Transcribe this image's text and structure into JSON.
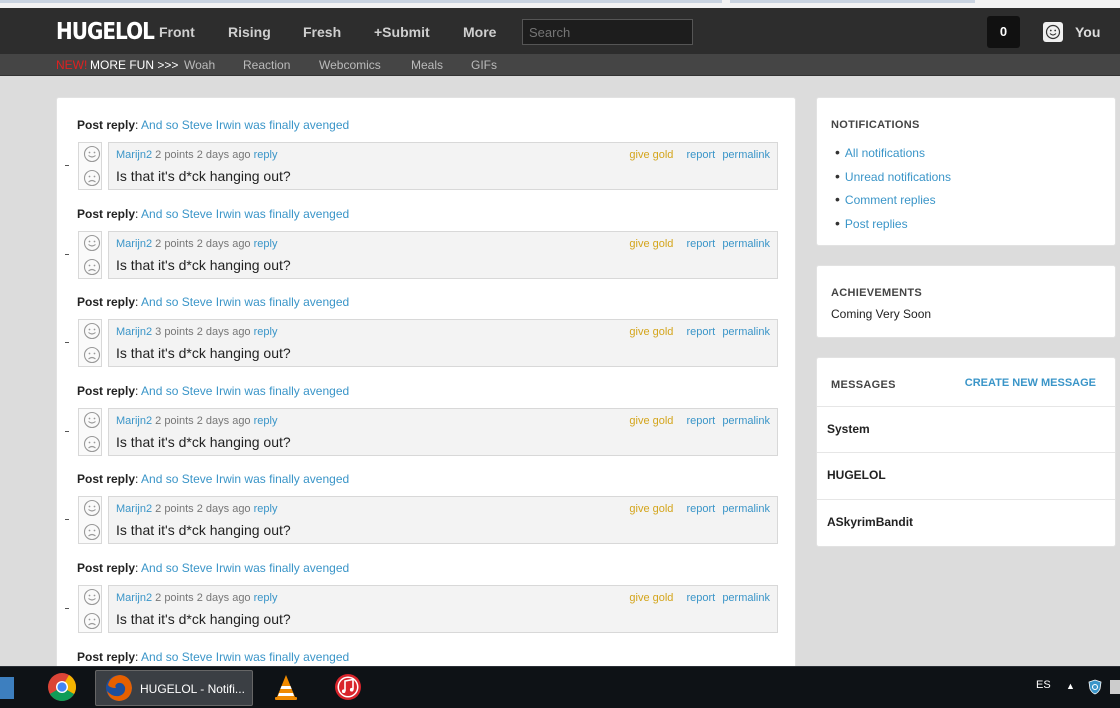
{
  "nav": {
    "logo": "HUGELOL",
    "links": [
      "Front",
      "Rising",
      "Fresh",
      "+Submit",
      "More"
    ],
    "search_placeholder": "Search",
    "notification_count": "0",
    "user": "You"
  },
  "subnav": {
    "new": "NEW!",
    "more_fun": "MORE FUN >>>",
    "links": [
      "Woah",
      "Reaction",
      "Webcomics",
      "Meals",
      "GIFs"
    ]
  },
  "post_reply_label": "Post reply",
  "post_reply_colon": ":",
  "entries": [
    {
      "post_title": "And so Steve Irwin was finally avenged",
      "author": "Marijn2",
      "points": "2 points",
      "age": "2 days ago",
      "reply": "reply",
      "give_gold": "give gold",
      "report": "report",
      "permalink": "permalink",
      "text": "Is that it's d*ck hanging out?"
    },
    {
      "post_title": "And so Steve Irwin was finally avenged",
      "author": "Marijn2",
      "points": "2 points",
      "age": "2 days ago",
      "reply": "reply",
      "give_gold": "give gold",
      "report": "report",
      "permalink": "permalink",
      "text": "Is that it's d*ck hanging out?"
    },
    {
      "post_title": "And so Steve Irwin was finally avenged",
      "author": "Marijn2",
      "points": "3 points",
      "age": "2 days ago",
      "reply": "reply",
      "give_gold": "give gold",
      "report": "report",
      "permalink": "permalink",
      "text": "Is that it's d*ck hanging out?"
    },
    {
      "post_title": "And so Steve Irwin was finally avenged",
      "author": "Marijn2",
      "points": "2 points",
      "age": "2 days ago",
      "reply": "reply",
      "give_gold": "give gold",
      "report": "report",
      "permalink": "permalink",
      "text": "Is that it's d*ck hanging out?"
    },
    {
      "post_title": "And so Steve Irwin was finally avenged",
      "author": "Marijn2",
      "points": "2 points",
      "age": "2 days ago",
      "reply": "reply",
      "give_gold": "give gold",
      "report": "report",
      "permalink": "permalink",
      "text": "Is that it's d*ck hanging out?"
    },
    {
      "post_title": "And so Steve Irwin was finally avenged",
      "author": "Marijn2",
      "points": "2 points",
      "age": "2 days ago",
      "reply": "reply",
      "give_gold": "give gold",
      "report": "report",
      "permalink": "permalink",
      "text": "Is that it's d*ck hanging out?"
    }
  ],
  "trailing_post_title": "And so Steve Irwin was finally avenged",
  "sidebar": {
    "notifications": {
      "title": "NOTIFICATIONS",
      "items": [
        "All notifications",
        "Unread notifications",
        "Comment replies",
        "Post replies"
      ]
    },
    "achievements": {
      "title": "ACHIEVEMENTS",
      "text": "Coming Very Soon"
    },
    "messages": {
      "title": "MESSAGES",
      "create": "CREATE NEW MESSAGE",
      "items": [
        "System",
        "HUGELOL",
        "ASkyrimBandit"
      ]
    }
  },
  "taskbar": {
    "active_window": "HUGELOL - Notifi...",
    "language": "ES",
    "icons": [
      "chrome-icon",
      "firefox-icon",
      "vlc-icon",
      "itunes-icon",
      "shield-icon",
      "speaker-icon"
    ]
  },
  "colors": {
    "link": "#3a95c8",
    "gold": "#d4a51c",
    "nav_bg": "#2d2d2d",
    "new_red": "#e02020"
  }
}
